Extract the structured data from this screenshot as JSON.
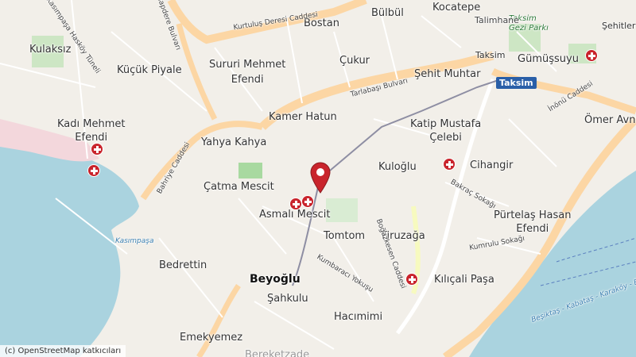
{
  "map": {
    "districts": {
      "bulbul": "Bülbül",
      "kocatepe": "Kocatepe",
      "bostan": "Bostan",
      "cukur": "Çukur",
      "sehit_muhtar": "Şehit Muhtar",
      "taksim": "Taksim",
      "gumussuyu": "Gümüşsuyu",
      "kulaksiz": "Kulaksız",
      "kucuk_piyale": "Küçük Piyale",
      "sururi": "Sururi Mehmet\nEfendi",
      "kamer_hatun": "Kamer Hatun",
      "katip_mustafa": "Katip Mustafa\nÇelebi",
      "kadi_mehmet": "Kadı Mehmet\nEfendi",
      "yahya_kahya": "Yahya Kahya",
      "kuloglu": "Kuloğlu",
      "cihangir": "Cihangir",
      "catma_mescit": "Çatma Mescit",
      "asmali_mescit": "Asmalı Mescit",
      "purtelas": "Pürtelaş Hasan\nEfendi",
      "omer_avni": "Ömer Avni",
      "tomtom": "Tomtom",
      "firuzaga": "Firuzağa",
      "bedrettin": "Bedrettin",
      "beyoglu": "Beyoğlu",
      "sahkulu": "Şahkulu",
      "kilicali": "Kılıçali Paşa",
      "hacimimi": "Hacımimi",
      "emekyemez": "Emekyemez",
      "bereketzade": "Bereketzade",
      "sehitler": "Şehitler"
    },
    "roads": {
      "kurtulus": "Kurtuluş Deresi Caddesi",
      "tarlabasi": "Tarlabaşı Bulvarı",
      "bahriye": "Bahriye Caddesi",
      "bogazkesen": "Boğazkesen Caddesi",
      "kumbaraci": "Kumbaracı Yokuşu",
      "inonu": "İnönü Caddesi",
      "bakraç": "Bakraç Sokağı",
      "kumrulu": "Kumrulu Sokağı",
      "dolapdere": "Dolapdere Bulvarı",
      "kasimpasa_hasköy": "Kasımpaşa Hasköy Tüneli",
      "kasimpasa": "Kasımpaşa",
      "taksim_park": "Taksim\nGezi Parkı",
      "talimhane": "Talimhane",
      "ferry": "Beşiktaş - Kabataş - Karaköy - Eyüp"
    },
    "taksim_station": "Taksim",
    "attribution": "(c) OpenStreetMap katkıcıları"
  }
}
